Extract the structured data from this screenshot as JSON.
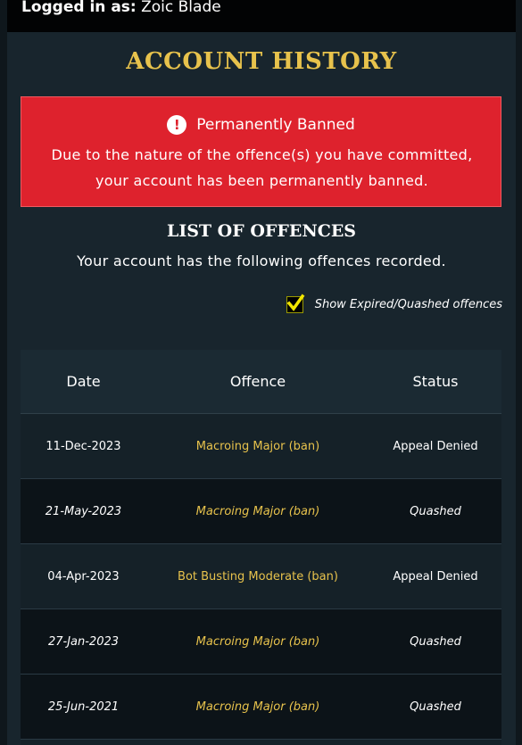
{
  "header": {
    "logged_in_label": "Logged in as:",
    "username": "Zoic Blade"
  },
  "page_title": "ACCOUNT HISTORY",
  "ban_notice": {
    "icon": "alert-icon",
    "icon_glyph": "!",
    "title": "Permanently Banned",
    "message": "Due to the nature of the offence(s) you have committed, your account has been permanently banned.",
    "color": "#de222d"
  },
  "offences": {
    "title": "LIST OF OFFENCES",
    "description": "Your account has the following offences recorded.",
    "show_expired": {
      "label": "Show Expired/Quashed offences",
      "checked": true
    },
    "columns": [
      "Date",
      "Offence",
      "Status"
    ],
    "rows": [
      {
        "date": "11-Dec-2023",
        "offence": "Macroing Major (ban)",
        "status": "Appeal Denied"
      },
      {
        "date": "21-May-2023",
        "offence": "Macroing Major (ban)",
        "status": "Quashed"
      },
      {
        "date": "04-Apr-2023",
        "offence": "Bot Busting Moderate (ban)",
        "status": "Appeal Denied"
      },
      {
        "date": "27-Jan-2023",
        "offence": "Macroing Major (ban)",
        "status": "Quashed"
      },
      {
        "date": "25-Jun-2021",
        "offence": "Macroing Major (ban)",
        "status": "Quashed"
      }
    ]
  },
  "colors": {
    "accent_gold": "#e7c24c",
    "background": "#0f171c",
    "panel": "#18252d"
  }
}
